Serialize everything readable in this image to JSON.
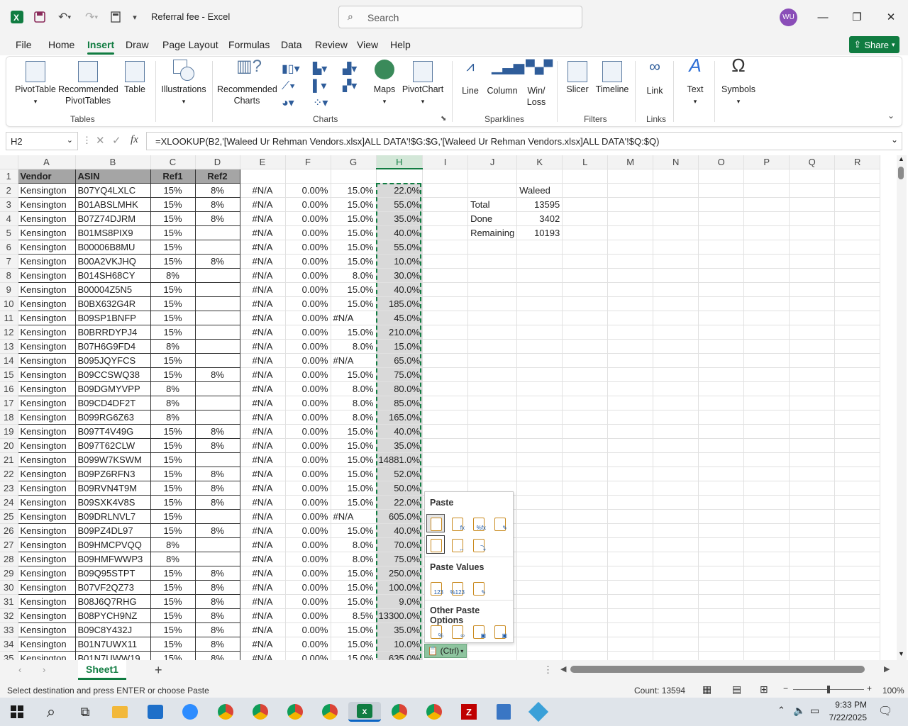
{
  "app": {
    "title": "Referral fee  -  Excel",
    "search_placeholder": "Search",
    "avatar": "WU",
    "share": "Share"
  },
  "menu": [
    "File",
    "Home",
    "Insert",
    "Draw",
    "Page Layout",
    "Formulas",
    "Data",
    "Review",
    "View",
    "Help"
  ],
  "ribbon": {
    "pivot_table": "PivotTable",
    "recommended_pivot": "Recommended PivotTables",
    "table": "Table",
    "illustrations": "Illustrations",
    "recommended_charts": "Recommended Charts",
    "maps": "Maps",
    "pivot_chart": "PivotChart",
    "line": "Line",
    "column": "Column",
    "winloss": "Win/ Loss",
    "slicer": "Slicer",
    "timeline": "Timeline",
    "link": "Link",
    "text": "Text",
    "symbols": "Symbols",
    "groups": {
      "tables": "Tables",
      "charts": "Charts",
      "sparklines": "Sparklines",
      "filters": "Filters",
      "links": "Links"
    }
  },
  "formula_bar": {
    "name_box": "H2",
    "fx": "fx",
    "formula": "=XLOOKUP(B2,'[Waleed Ur Rehman Vendors.xlsx]ALL DATA'!$G:$G,'[Waleed Ur Rehman Vendors.xlsx]ALL DATA'!$Q:$Q)"
  },
  "columns": [
    "A",
    "B",
    "C",
    "D",
    "E",
    "F",
    "G",
    "H",
    "I",
    "J",
    "K",
    "L",
    "M",
    "N",
    "O",
    "P",
    "Q",
    "R"
  ],
  "header_row": {
    "vendor": "Vendor",
    "asin": "ASIN",
    "ref1": "Ref1",
    "ref2": "Ref2"
  },
  "rows": [
    [
      "Kensington",
      "B07YQ4LXLC",
      "15%",
      "8%",
      "#N/A",
      "0.00%",
      "15.0%",
      "22.0%"
    ],
    [
      "Kensington",
      "B01ABSLMHK",
      "15%",
      "8%",
      "#N/A",
      "0.00%",
      "15.0%",
      "55.0%"
    ],
    [
      "Kensington",
      "B07Z74DJRM",
      "15%",
      "8%",
      "#N/A",
      "0.00%",
      "15.0%",
      "35.0%"
    ],
    [
      "Kensington",
      "B01MS8PIX9",
      "15%",
      "",
      "#N/A",
      "0.00%",
      "15.0%",
      "40.0%"
    ],
    [
      "Kensington",
      "B00006B8MU",
      "15%",
      "",
      "#N/A",
      "0.00%",
      "15.0%",
      "55.0%"
    ],
    [
      "Kensington",
      "B00A2VKJHQ",
      "15%",
      "8%",
      "#N/A",
      "0.00%",
      "15.0%",
      "10.0%"
    ],
    [
      "Kensington",
      "B014SH68CY",
      "8%",
      "",
      "#N/A",
      "0.00%",
      "8.0%",
      "30.0%"
    ],
    [
      "Kensington",
      "B00004Z5N5",
      "15%",
      "",
      "#N/A",
      "0.00%",
      "15.0%",
      "40.0%"
    ],
    [
      "Kensington",
      "B0BX632G4R",
      "15%",
      "",
      "#N/A",
      "0.00%",
      "15.0%",
      "185.0%"
    ],
    [
      "Kensington",
      "B09SP1BNFP",
      "15%",
      "",
      "#N/A",
      "0.00%",
      "#N/A",
      "45.0%"
    ],
    [
      "Kensington",
      "B0BRRDYPJ4",
      "15%",
      "",
      "#N/A",
      "0.00%",
      "15.0%",
      "210.0%"
    ],
    [
      "Kensington",
      "B07H6G9FD4",
      "8%",
      "",
      "#N/A",
      "0.00%",
      "8.0%",
      "15.0%"
    ],
    [
      "Kensington",
      "B095JQYFCS",
      "15%",
      "",
      "#N/A",
      "0.00%",
      "#N/A",
      "65.0%"
    ],
    [
      "Kensington",
      "B09CCSWQ38",
      "15%",
      "8%",
      "#N/A",
      "0.00%",
      "15.0%",
      "75.0%"
    ],
    [
      "Kensington",
      "B09DGMYVPP",
      "8%",
      "",
      "#N/A",
      "0.00%",
      "8.0%",
      "80.0%"
    ],
    [
      "Kensington",
      "B09CD4DF2T",
      "8%",
      "",
      "#N/A",
      "0.00%",
      "8.0%",
      "85.0%"
    ],
    [
      "Kensington",
      "B099RG6Z63",
      "8%",
      "",
      "#N/A",
      "0.00%",
      "8.0%",
      "165.0%"
    ],
    [
      "Kensington",
      "B097T4V49G",
      "15%",
      "8%",
      "#N/A",
      "0.00%",
      "15.0%",
      "40.0%"
    ],
    [
      "Kensington",
      "B097T62CLW",
      "15%",
      "8%",
      "#N/A",
      "0.00%",
      "15.0%",
      "35.0%"
    ],
    [
      "Kensington",
      "B099W7KSWM",
      "15%",
      "",
      "#N/A",
      "0.00%",
      "15.0%",
      "14881.0%"
    ],
    [
      "Kensington",
      "B09PZ6RFN3",
      "15%",
      "8%",
      "#N/A",
      "0.00%",
      "15.0%",
      "52.0%"
    ],
    [
      "Kensington",
      "B09RVN4T9M",
      "15%",
      "8%",
      "#N/A",
      "0.00%",
      "15.0%",
      "50.0%"
    ],
    [
      "Kensington",
      "B09SXK4V8S",
      "15%",
      "8%",
      "#N/A",
      "0.00%",
      "15.0%",
      "22.0%"
    ],
    [
      "Kensington",
      "B09DRLNVL7",
      "15%",
      "",
      "#N/A",
      "0.00%",
      "#N/A",
      "605.0%"
    ],
    [
      "Kensington",
      "B09PZ4DL97",
      "15%",
      "8%",
      "#N/A",
      "0.00%",
      "15.0%",
      "40.0%"
    ],
    [
      "Kensington",
      "B09HMCPVQQ",
      "8%",
      "",
      "#N/A",
      "0.00%",
      "8.0%",
      "70.0%"
    ],
    [
      "Kensington",
      "B09HMFWWP3",
      "8%",
      "",
      "#N/A",
      "0.00%",
      "8.0%",
      "75.0%"
    ],
    [
      "Kensington",
      "B09Q95STPT",
      "15%",
      "8%",
      "#N/A",
      "0.00%",
      "15.0%",
      "250.0%"
    ],
    [
      "Kensington",
      "B07VF2QZ73",
      "15%",
      "8%",
      "#N/A",
      "0.00%",
      "15.0%",
      "100.0%"
    ],
    [
      "Kensington",
      "B08J6Q7RHG",
      "15%",
      "8%",
      "#N/A",
      "0.00%",
      "15.0%",
      "9.0%"
    ],
    [
      "Kensington",
      "B08PYCH9NZ",
      "15%",
      "8%",
      "#N/A",
      "0.00%",
      "8.5%",
      "13300.0%"
    ],
    [
      "Kensington",
      "B09C8Y432J",
      "15%",
      "8%",
      "#N/A",
      "0.00%",
      "15.0%",
      "35.0%"
    ],
    [
      "Kensington",
      "B01N7UWX11",
      "15%",
      "8%",
      "#N/A",
      "0.00%",
      "15.0%",
      "10.0%"
    ],
    [
      "Kensington",
      "B01N7UWW19",
      "15%",
      "8%",
      "#N/A",
      "0.00%",
      "15.0%",
      "635.0%"
    ]
  ],
  "summary": {
    "name": "Waleed",
    "total_label": "Total",
    "total": "13595",
    "done_label": "Done",
    "done": "3402",
    "remaining_label": "Remaining",
    "remaining": "10193"
  },
  "paste_menu": {
    "paste": "Paste",
    "paste_values": "Paste Values",
    "other": "Other Paste Options",
    "ctrl": "(Ctrl)"
  },
  "sheet": {
    "name": "Sheet1"
  },
  "status": {
    "message": "Select destination and press ENTER or choose Paste",
    "count": "Count: 13594",
    "zoom": "100%"
  },
  "clock": {
    "time": "9:33 PM",
    "date": "7/22/2025"
  },
  "colors": {
    "excel_green": "#107c41",
    "header_fill": "#a5a5a5",
    "selection": "#d9d9d9"
  }
}
